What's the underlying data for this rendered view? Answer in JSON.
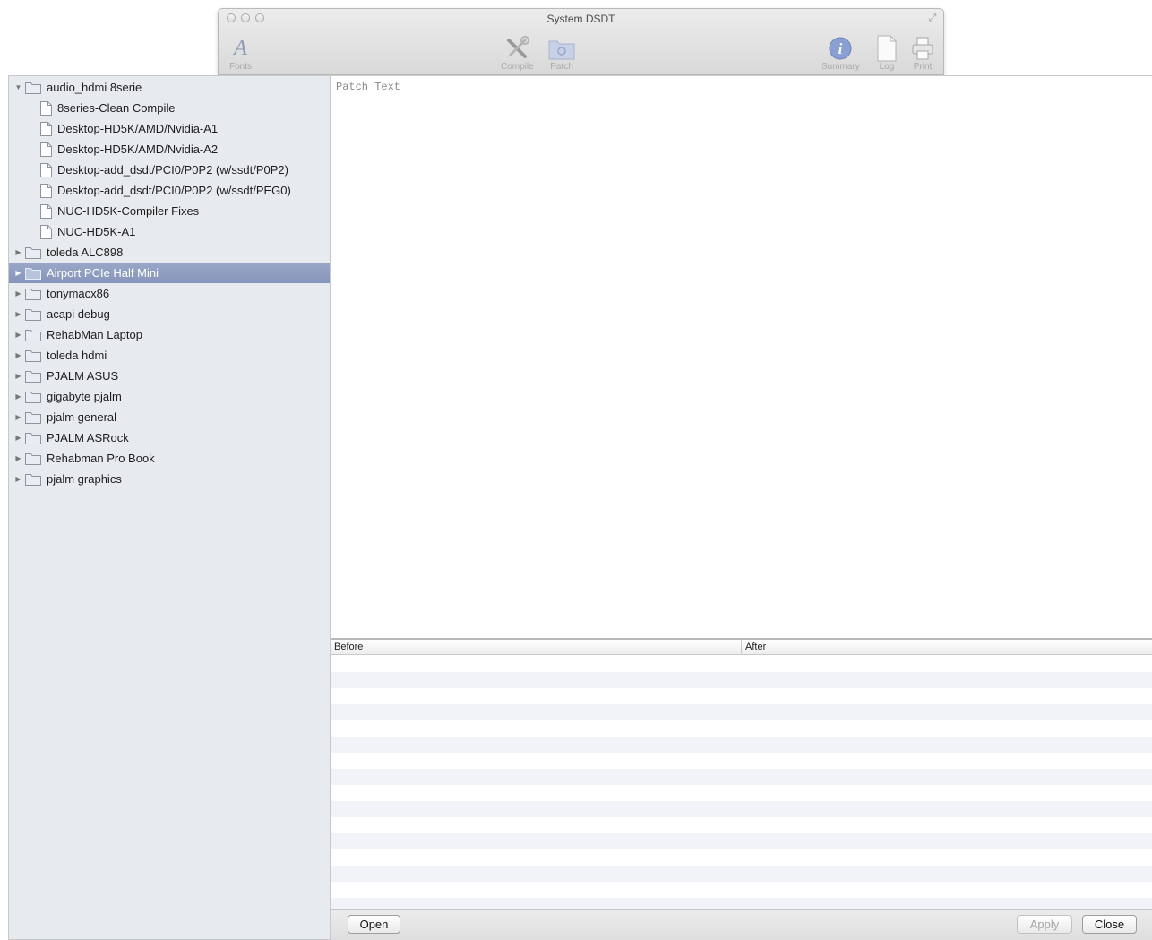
{
  "window": {
    "title": "System DSDT"
  },
  "toolbar": {
    "fonts_label": "Fonts",
    "compile_label": "Compile",
    "patch_label": "Patch",
    "summary_label": "Summary",
    "log_label": "Log",
    "print_label": "Print"
  },
  "sidebar": {
    "items": [
      {
        "label": "audio_hdmi 8serie",
        "type": "folder",
        "expanded": true
      },
      {
        "label": "8series-Clean Compile",
        "type": "file"
      },
      {
        "label": "Desktop-HD5K/AMD/Nvidia-A1",
        "type": "file"
      },
      {
        "label": "Desktop-HD5K/AMD/Nvidia-A2",
        "type": "file"
      },
      {
        "label": "Desktop-add_dsdt/PCI0/P0P2 (w/ssdt/P0P2)",
        "type": "file"
      },
      {
        "label": "Desktop-add_dsdt/PCI0/P0P2 (w/ssdt/PEG0)",
        "type": "file"
      },
      {
        "label": "NUC-HD5K-Compiler Fixes",
        "type": "file"
      },
      {
        "label": "NUC-HD5K-A1",
        "type": "file"
      },
      {
        "label": "toleda ALC898",
        "type": "folder"
      },
      {
        "label": "Airport PCIe Half Mini",
        "type": "folder",
        "selected": true
      },
      {
        "label": "tonymacx86",
        "type": "folder"
      },
      {
        "label": "acapi debug",
        "type": "folder"
      },
      {
        "label": "RehabMan Laptop",
        "type": "folder"
      },
      {
        "label": "toleda hdmi",
        "type": "folder"
      },
      {
        "label": "PJALM ASUS",
        "type": "folder"
      },
      {
        "label": "gigabyte pjalm",
        "type": "folder"
      },
      {
        "label": "pjalm general",
        "type": "folder"
      },
      {
        "label": "PJALM ASRock",
        "type": "folder"
      },
      {
        "label": "Rehabman Pro Book",
        "type": "folder"
      },
      {
        "label": "pjalm graphics",
        "type": "folder"
      }
    ]
  },
  "patch": {
    "text": "Patch Text"
  },
  "table": {
    "headers": [
      "Before",
      "After"
    ]
  },
  "buttons": {
    "open": "Open",
    "apply": "Apply",
    "close": "Close"
  },
  "colors": {
    "selection": "#8b98bd",
    "sidebar_bg": "#e7eaee",
    "stripe": "#f1f3f8"
  }
}
